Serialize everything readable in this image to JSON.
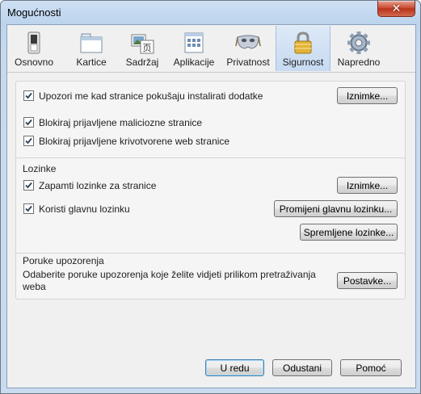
{
  "window": {
    "title": "Mogućnosti",
    "close_glyph": "✕"
  },
  "tabs": [
    {
      "id": "general",
      "label": "Osnovno",
      "icon": "switch-icon",
      "selected": false
    },
    {
      "id": "tabs",
      "label": "Kartice",
      "icon": "tabs-window-icon",
      "selected": false
    },
    {
      "id": "content",
      "label": "Sadržaj",
      "icon": "content-pictures-icon",
      "selected": false
    },
    {
      "id": "applications",
      "label": "Aplikacije",
      "icon": "applications-window-icon",
      "selected": false
    },
    {
      "id": "privacy",
      "label": "Privatnost",
      "icon": "mask-icon",
      "selected": false
    },
    {
      "id": "security",
      "label": "Sigurnost",
      "icon": "padlock-icon",
      "selected": true
    },
    {
      "id": "advanced",
      "label": "Napredno",
      "icon": "gear-icon",
      "selected": false
    }
  ],
  "addons_group": {
    "warn_addons": {
      "label": "Upozori me kad stranice pokušaju instalirati dodatke",
      "checked": true
    },
    "exceptions_button": "Iznimke...",
    "block_malware": {
      "label": "Blokiraj prijavljene maliciozne stranice",
      "checked": true
    },
    "block_forgery": {
      "label": "Blokiraj prijavljene krivotvorene web stranice",
      "checked": true
    }
  },
  "passwords_group": {
    "caption": "Lozinke",
    "remember": {
      "label": "Zapamti lozinke za stranice",
      "checked": true
    },
    "exceptions_button": "Iznimke...",
    "master": {
      "label": "Koristi glavnu lozinku",
      "checked": true
    },
    "change_master_button": "Promijeni glavnu lozinku...",
    "saved_button": "Spremljene lozinke..."
  },
  "warnings_group": {
    "caption": "Poruke upozorenja",
    "description": "Odaberite poruke upozorenja koje želite vidjeti prilikom pretraživanja weba",
    "settings_button": "Postavke..."
  },
  "footer": {
    "ok_button": "U redu",
    "cancel_button": "Odustani",
    "help_button": "Pomoć"
  }
}
